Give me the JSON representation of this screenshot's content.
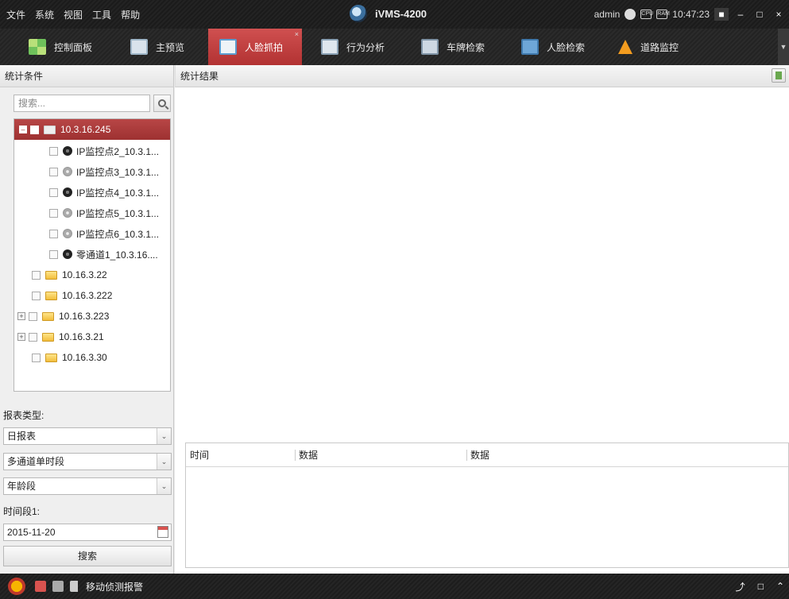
{
  "menus": [
    "文件",
    "系统",
    "视图",
    "工具",
    "帮助"
  ],
  "app_title": "iVMS-4200",
  "status": {
    "user": "admin",
    "time": "10:47:23",
    "cpu_label": "CPU",
    "ram_label": "RAM"
  },
  "tabs": [
    {
      "label": "控制面板",
      "icon": "dashboard-grid-icon"
    },
    {
      "label": "主预览",
      "icon": "main-preview-monitor-icon"
    },
    {
      "label": "人脸抓拍",
      "icon": "face-capture-icon",
      "active": true
    },
    {
      "label": "行为分析",
      "icon": "behavior-analysis-icon"
    },
    {
      "label": "车牌检索",
      "icon": "plate-search-icon"
    },
    {
      "label": "人脸检索",
      "icon": "face-search-icon"
    },
    {
      "label": "道路监控",
      "icon": "road-monitor-cone-icon"
    }
  ],
  "left": {
    "header": "统计条件",
    "search_placeholder": "搜索...",
    "tree": {
      "root": "10.3.16.245",
      "cameras": [
        {
          "label": "IP监控点2_10.3.1...",
          "online": true
        },
        {
          "label": "IP监控点3_10.3.1...",
          "online": false
        },
        {
          "label": "IP监控点4_10.3.1...",
          "online": true
        },
        {
          "label": "IP监控点5_10.3.1...",
          "online": false
        },
        {
          "label": "IP监控点6_10.3.1...",
          "online": false
        },
        {
          "label": "零通道1_10.3.16....",
          "online": true
        }
      ],
      "groups": [
        {
          "label": "10.16.3.22",
          "expandable": false
        },
        {
          "label": "10.16.3.222",
          "expandable": false
        },
        {
          "label": "10.16.3.223",
          "expandable": true
        },
        {
          "label": "10.16.3.21",
          "expandable": true
        },
        {
          "label": "10.16.3.30",
          "expandable": false
        }
      ]
    },
    "report_type_label": "报表类型:",
    "report_type": "日报表",
    "stat_mode": "多通道单时段",
    "stat_dimension": "年龄段",
    "time_period_label": "时间段1:",
    "date": "2015-11-20",
    "search_button": "搜索"
  },
  "main": {
    "header": "统计结果",
    "columns": [
      "时间",
      "数据",
      "数据"
    ]
  },
  "statusbar": {
    "alarm_text": "移动侦测报警"
  }
}
